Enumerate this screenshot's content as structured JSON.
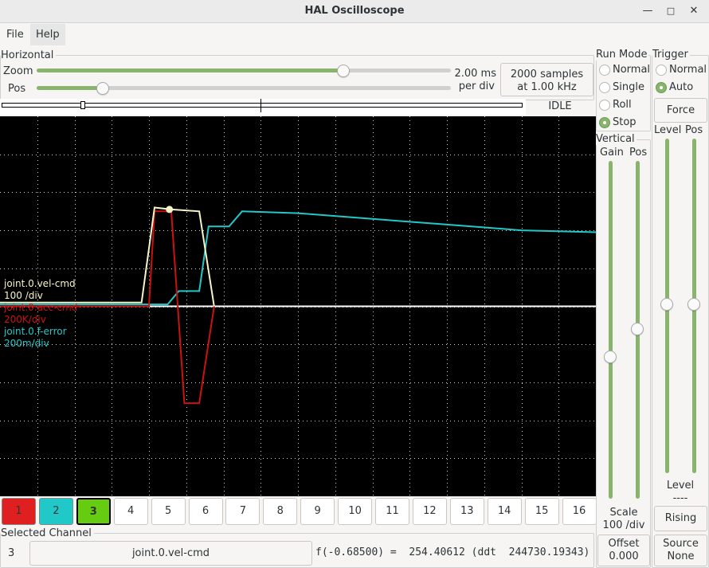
{
  "window": {
    "title": "HAL Oscilloscope"
  },
  "menu": {
    "items": [
      "File",
      "Help"
    ]
  },
  "horizontal": {
    "frame_label": "Horizontal",
    "zoom_label": "Zoom",
    "zoom_level": 0.74,
    "pos_label": "Pos",
    "pos_level": 0.16,
    "rate_line1": "2.00 ms",
    "rate_line2": "per div",
    "samples_line1": "2000 samples",
    "samples_line2": "at 1.00 kHz",
    "status": "IDLE"
  },
  "run_mode": {
    "label": "Run Mode",
    "options": [
      "Normal",
      "Single",
      "Roll",
      "Stop"
    ],
    "selected": "Stop"
  },
  "trigger": {
    "label": "Trigger",
    "options": [
      "Normal",
      "Auto"
    ],
    "selected": "Auto",
    "force_label": "Force",
    "level_header": "Level",
    "pos_header": "Pos",
    "level_label": "Level",
    "level_value": "----",
    "edge_label": "Rising",
    "source_label": "Source",
    "source_value": "None"
  },
  "vertical": {
    "label": "Vertical",
    "gain_label": "Gain",
    "pos_label": "Pos",
    "scale_label": "Scale",
    "scale_value": "100 /div",
    "offset_label": "Offset",
    "offset_value": "0.000"
  },
  "legend": [
    {
      "name": "joint.0.vel-cmd",
      "scale": "100 /div",
      "color": "#f5f5c8"
    },
    {
      "name": "joint.0.acc-cmd",
      "scale": "200K/div",
      "color": "#cc1111"
    },
    {
      "name": "joint.0.f-error",
      "scale": "200m/div",
      "color": "#22c8c8"
    }
  ],
  "channels": {
    "labels": [
      "1",
      "2",
      "3",
      "4",
      "5",
      "6",
      "7",
      "8",
      "9",
      "10",
      "11",
      "12",
      "13",
      "14",
      "15",
      "16"
    ],
    "colors": {
      "1": "#e02020",
      "2": "#20c8c8",
      "3": "#66cc11"
    },
    "selected": "3"
  },
  "selected_channel": {
    "label": "Selected Channel",
    "number": "3",
    "name": "joint.0.vel-cmd",
    "readout": "f(-0.68500) =  254.40612 (ddt  244730.19343)"
  },
  "chart_data": {
    "type": "line",
    "grid": true,
    "x_divisions": 16,
    "y_divisions": 10,
    "series": [
      {
        "name": "joint.0.vel-cmd",
        "color": "#f5f5c8",
        "x": [
          0,
          3.8,
          4.15,
          4.6,
          5.35,
          5.75
        ],
        "y": [
          0.1,
          0.1,
          2.6,
          2.55,
          2.5,
          0
        ]
      },
      {
        "name": "joint.0.acc-cmd",
        "color": "#cc1111",
        "x": [
          0,
          4.0,
          4.15,
          4.6,
          4.95,
          5.35,
          5.75
        ],
        "y": [
          0,
          0,
          2.5,
          2.5,
          -2.55,
          -2.55,
          0
        ]
      },
      {
        "name": "joint.0.f-error",
        "color": "#22c8c8",
        "x": [
          0,
          4.5,
          4.8,
          5.35,
          5.6,
          6.15,
          6.5,
          8,
          10,
          12,
          14,
          16
        ],
        "y": [
          0.05,
          0.05,
          0.4,
          0.4,
          2.1,
          2.1,
          2.5,
          2.45,
          2.3,
          2.15,
          2.0,
          1.95
        ]
      }
    ]
  }
}
